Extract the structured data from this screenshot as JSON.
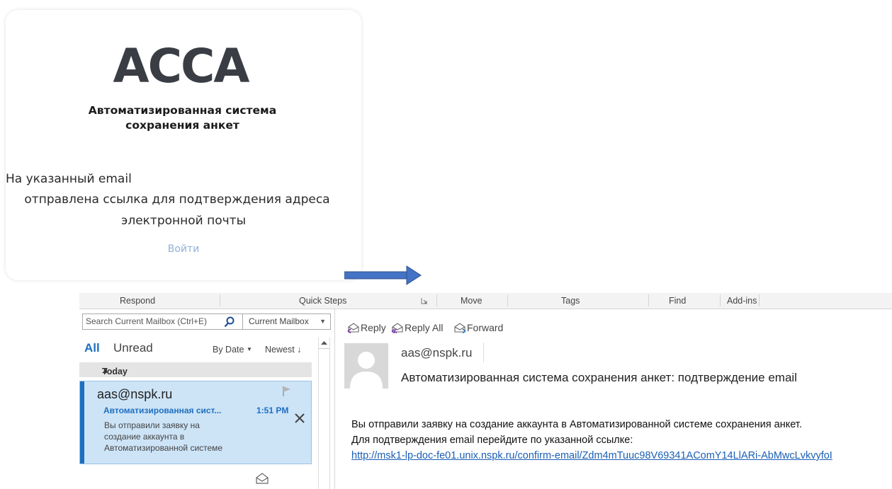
{
  "card": {
    "logo_text": "АССА",
    "subtitle_line1": "Автоматизированная система",
    "subtitle_line2": "сохранения анкет",
    "message_line1": "На указанный email",
    "message_line2": "отправлена ссылка для подтверждения адреса",
    "message_line3": "электронной почты",
    "login_link": "Войти"
  },
  "colors": {
    "accent_blue": "#1e6fbf",
    "selected_item": "#cde4f7",
    "link_light": "#8fb0da",
    "arrow": "#4472c4"
  },
  "ribbon": {
    "groups": [
      "Respond",
      "Quick Steps",
      "Move",
      "Tags",
      "Find",
      "Add-ins"
    ]
  },
  "search": {
    "placeholder": "Search Current Mailbox (Ctrl+E)",
    "scope": "Current Mailbox"
  },
  "filters": {
    "all": "All",
    "unread": "Unread",
    "sort_by": "By Date",
    "order": "Newest"
  },
  "group_header": "Today",
  "mail_item": {
    "sender": "aas@nspk.ru",
    "subject": "Автоматизированная сист...",
    "time": "1:51 PM",
    "preview_lines": [
      "Вы отправили заявку на",
      "создание аккаунта в",
      "Автоматизированной системе"
    ]
  },
  "reading_pane": {
    "actions": [
      "Reply",
      "Reply All",
      "Forward"
    ],
    "from": "aas@nspk.ru",
    "subject": "Автоматизированная система сохранения анкет: подтверждение email",
    "body_line1": "Вы отправили заявку на создание аккаунта в Автоматизированной системе сохранения анкет.",
    "body_line2": "Для подтверждения email перейдите по указанной ссылке:",
    "body_link": "http://msk1-lp-doc-fe01.unix.nspk.ru/confirm-email/Zdm4mTuuc98V69341AComY14LlARi-AbMwcLvkvyfoI"
  },
  "icons": [
    "flag-icon",
    "delete-icon",
    "search-icon",
    "reply-icon",
    "reply-all-icon",
    "forward-icon",
    "open-envelope-icon",
    "arrow-right-icon"
  ]
}
